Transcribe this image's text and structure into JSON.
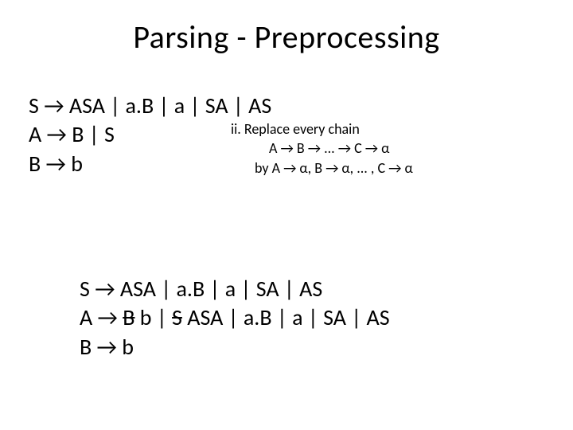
{
  "title": "Parsing - Preprocessing",
  "top_grammar": {
    "line1": "S → ASA | a.B | a | SA | AS",
    "line2": "A → B | S",
    "line3": "B → b"
  },
  "note": {
    "line1": "ii. Replace every chain",
    "line2": "A → B → ... → C → α",
    "line3": "by A → α, B → α, ... , C → α"
  },
  "bottom_grammar": {
    "line1": "S → ASA | a.B | a | SA | AS",
    "line2_pre": "A → ",
    "line2_strike1": "B",
    "line2_mid1": " b | ",
    "line2_strike2": "S",
    "line2_rest": " ASA | a.B | a | SA | AS",
    "line3": "B → b"
  }
}
